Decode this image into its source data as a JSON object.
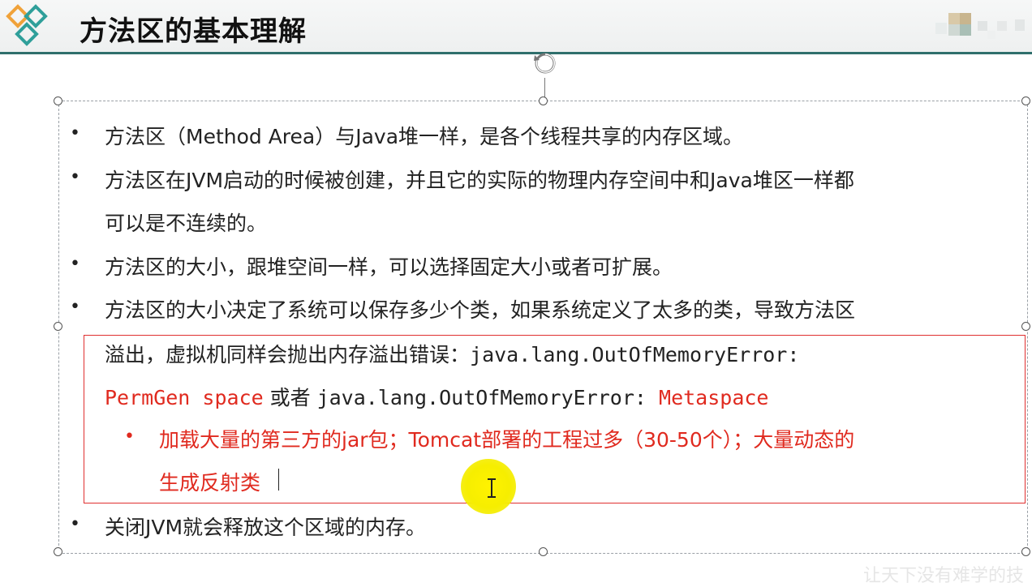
{
  "slide": {
    "title": "方法区的基本理解",
    "watermark": "让天下没有难学的技"
  },
  "bullets": [
    {
      "lines": [
        "方法区（Method Area）与Java堆一样，是各个线程共享的内存区域。"
      ]
    },
    {
      "lines": [
        "方法区在JVM启动的时候被创建，并且它的实际的物理内存空间中和Java堆区一样都",
        "可以是不连续的。"
      ]
    },
    {
      "lines": [
        "方法区的大小，跟堆空间一样，可以选择固定大小或者可扩展。"
      ]
    },
    {
      "line1": "方法区的大小决定了系统可以保存多少个类，如果系统定义了太多的类，导致方法区",
      "line2_text": "溢出，虚拟机同样会抛出内存溢出错误：",
      "line2_code": "java.lang.OutOfMemoryError:",
      "line3_red1": "PermGen space",
      "line3_or": " 或者 ",
      "line3_code": "java.lang.OutOfMemoryError:",
      "line3_red2": " Metaspace",
      "sub": {
        "line1": "加载大量的第三方的jar包；Tomcat部署的工程过多（30-50个）；大量动态的",
        "line2": "生成反射类"
      }
    },
    {
      "lines": [
        "关闭JVM就会释放这个区域的内存。"
      ]
    }
  ],
  "bullet_symbol": "•",
  "colors": {
    "accent_teal": "#2f6f6c",
    "logo_orange": "#f0a23a",
    "highlight_red": "#e02a1f",
    "cursor_yellow": "#fff200"
  },
  "icons": [
    "diamond-logo-icon",
    "rotate-handle-icon",
    "text-cursor-icon"
  ]
}
